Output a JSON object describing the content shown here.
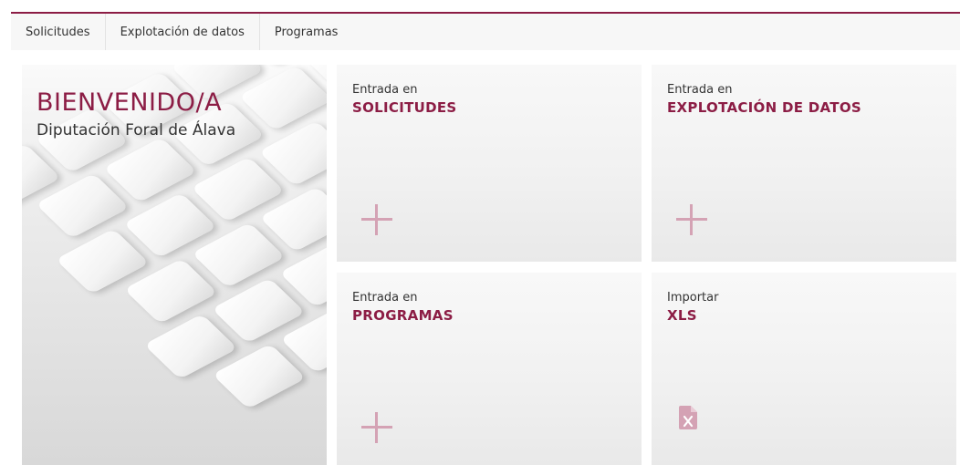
{
  "nav": {
    "items": [
      "Solicitudes",
      "Explotación de datos",
      "Programas"
    ]
  },
  "welcome": {
    "title": "BIENVENIDO/A",
    "subtitle": "Diputación Foral de Álava"
  },
  "cards": [
    {
      "label": "Entrada en",
      "title": "SOLICITUDES",
      "icon": "plus-icon"
    },
    {
      "label": "Entrada en",
      "title": "EXPLOTACIÓN DE DATOS",
      "icon": "plus-icon"
    },
    {
      "label": "Entrada en",
      "title": "PROGRAMAS",
      "icon": "plus-icon"
    },
    {
      "label": "Importar",
      "title": "XLS",
      "icon": "xls-file-icon"
    }
  ],
  "colors": {
    "accent": "#8c1d45",
    "icon": "#d4a2b4"
  }
}
